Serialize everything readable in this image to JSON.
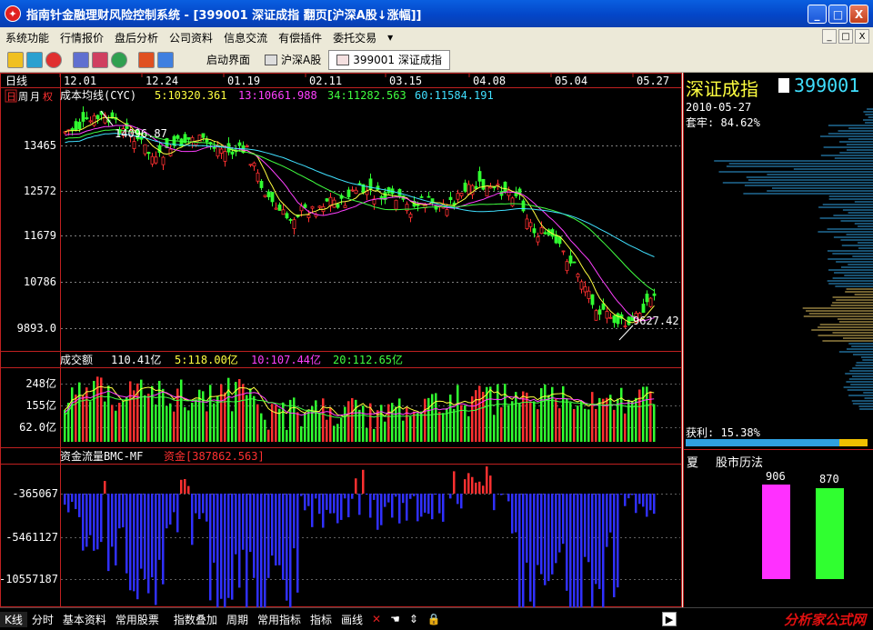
{
  "window": {
    "title": "指南针金融理财风险控制系统 - [399001 深证成指 翻页[沪深A股↓涨幅]]",
    "icon": "compass-logo-icon",
    "controls": [
      "_",
      "□",
      "X"
    ]
  },
  "menu": [
    "系统功能",
    "行情报价",
    "盘后分析",
    "公司资料",
    "信息交流",
    "有偿插件",
    "委托交易"
  ],
  "menu_more": "▾",
  "toolbar": {
    "icons": [
      "key-icon",
      "monitor-icon",
      "help-icon",
      "quote-grid-icon",
      "kline-icon",
      "globe-icon",
      "info-icon",
      "list-icon"
    ],
    "tabs": [
      {
        "label": "启动界面",
        "active": false
      },
      {
        "label": "沪深A股",
        "active": false
      },
      {
        "label": "399001 深证成指",
        "active": true
      }
    ]
  },
  "chart": {
    "period_label": "日线",
    "period_buttons": [
      "日",
      "周",
      "月",
      "权"
    ],
    "ma_header": {
      "name": "成本均线(CYC)",
      "items": [
        {
          "label": "5:10320.361",
          "color": "#ffff40"
        },
        {
          "label": "13:10661.988",
          "color": "#ff40ff"
        },
        {
          "label": "34:11282.563",
          "color": "#40ff40"
        },
        {
          "label": "60:11584.191",
          "color": "#40e0ff"
        }
      ]
    },
    "dates": [
      "12.01",
      "12.24",
      "01.19",
      "02.11",
      "03.15",
      "04.08",
      "05.04",
      "05.27"
    ],
    "price_ticks": [
      "13465",
      "12572",
      "11679",
      "10786",
      "9893.0"
    ],
    "high_label": "14096.87",
    "low_label": "9627.42",
    "volume_header": {
      "name": "成交额",
      "value": "110.41亿",
      "items": [
        {
          "label": "5:118.00亿",
          "color": "#ffff40"
        },
        {
          "label": "10:107.44亿",
          "color": "#ff40ff"
        },
        {
          "label": "20:112.65亿",
          "color": "#40ff40"
        }
      ]
    },
    "volume_ticks": [
      "248亿",
      "155亿",
      "62.0亿"
    ],
    "flow_header": {
      "name": "资金流量BMC-MF",
      "value": "资金[387862.563]",
      "value_color": "#ff3030"
    },
    "flow_ticks": [
      "-365067",
      "-5461127",
      "-10557187"
    ]
  },
  "right_panel": {
    "index_name": "深证成指",
    "index_code": "399001",
    "date": "2010-05-27",
    "trapped_label": "套牢:",
    "trapped_value": "84.62%",
    "profit_label": "获利:",
    "profit_value": "15.38%",
    "profit_ratio": 0.8462,
    "season": "夏",
    "calendar_title": "股市历法",
    "bars": [
      {
        "value": "906",
        "color": "#ff30ff"
      },
      {
        "value": "870",
        "color": "#30ff30"
      }
    ]
  },
  "bottom_bar": {
    "items": [
      {
        "label": "K线",
        "active": true
      },
      {
        "label": "分时",
        "active": false
      },
      {
        "label": "基本资料",
        "active": false
      },
      {
        "label": "常用股票",
        "active": false
      },
      {
        "label": "指数叠加",
        "active": false
      },
      {
        "label": "周期",
        "active": false
      },
      {
        "label": "常用指标",
        "active": false
      },
      {
        "label": "指标",
        "active": false
      },
      {
        "label": "画线",
        "active": false
      }
    ],
    "tool_icons": [
      "close-x-icon",
      "hand-icon",
      "move-arrows-icon",
      "lock-icon"
    ],
    "watermark": "分析家公式网",
    "watermark_url": "www.88gs.com"
  }
}
